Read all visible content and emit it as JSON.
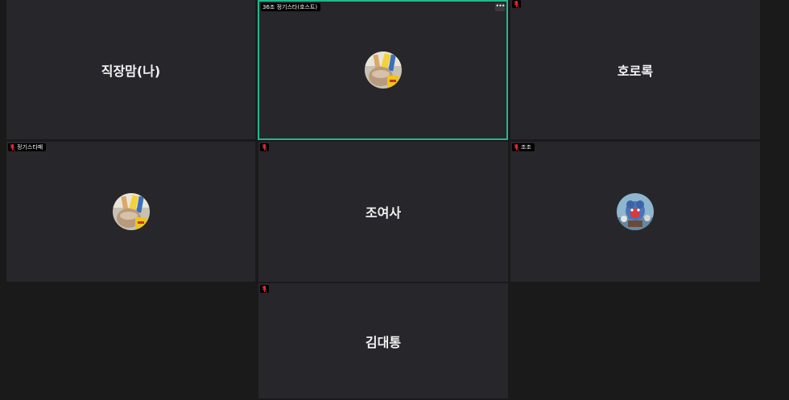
{
  "colors": {
    "background": "#1a1a1a",
    "tile": "#27272b",
    "active_border": "#1fb98a",
    "mic_muted": "#e0292f"
  },
  "participants": [
    {
      "id": "p1",
      "name": "직장맘(나)",
      "label": "",
      "display": "name",
      "muted": false,
      "active": false
    },
    {
      "id": "p2",
      "name": "",
      "label": "36조 정기스타(호스트)",
      "display": "avatar",
      "avatar_icon": "bread-jar-photo-icon",
      "muted": false,
      "active": true,
      "more_label": "•••"
    },
    {
      "id": "p3",
      "name": "호로록",
      "label": "",
      "display": "name",
      "muted": true,
      "active": false
    },
    {
      "id": "p4",
      "name": "",
      "label": "정기스타패",
      "display": "avatar",
      "avatar_icon": "bread-jar-photo-icon",
      "muted": true,
      "active": false
    },
    {
      "id": "p5",
      "name": "조여사",
      "label": "",
      "display": "name",
      "muted": true,
      "active": false
    },
    {
      "id": "p6",
      "name": "",
      "label": "조조",
      "display": "avatar",
      "avatar_icon": "toy-figure-photo-icon",
      "muted": true,
      "active": false
    },
    {
      "id": "p7",
      "name": "김대통",
      "label": "",
      "display": "name",
      "muted": true,
      "active": false
    }
  ]
}
